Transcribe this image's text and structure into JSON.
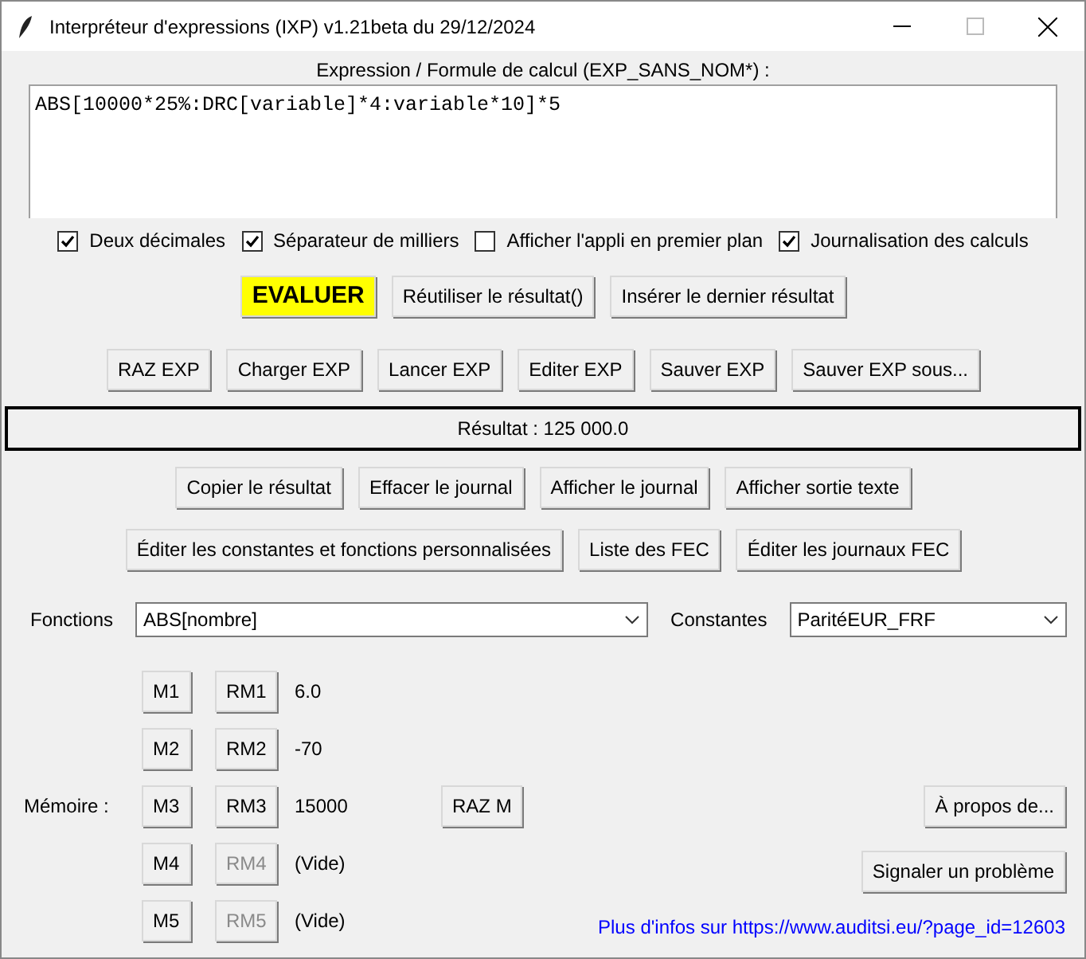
{
  "window": {
    "title": "Interpréteur d'expressions (IXP) v1.21beta du 29/12/2024"
  },
  "expression": {
    "label": "Expression / Formule de calcul (EXP_SANS_NOM*) :",
    "value": "ABS[10000*25%:DRC[variable]*4:variable*10]*5"
  },
  "options": [
    {
      "label": "Deux décimales",
      "checked": true
    },
    {
      "label": "Séparateur de milliers",
      "checked": true
    },
    {
      "label": "Afficher l'appli en premier plan",
      "checked": false
    },
    {
      "label": "Journalisation des calculs",
      "checked": true
    }
  ],
  "action_buttons": [
    {
      "label": "EVALUER",
      "kind": "primary"
    },
    {
      "label": "Réutiliser le résultat()",
      "kind": "normal"
    },
    {
      "label": "Insérer le dernier résultat",
      "kind": "normal"
    }
  ],
  "file_buttons": [
    "RAZ EXP",
    "Charger EXP",
    "Lancer EXP",
    "Editer EXP",
    "Sauver EXP",
    "Sauver EXP sous..."
  ],
  "result": "Résultat : 125 000.0",
  "journal_buttons": [
    "Copier le résultat",
    "Effacer le journal",
    "Afficher le journal",
    "Afficher sortie texte"
  ],
  "fec_buttons": [
    "Éditer les constantes et fonctions personnalisées",
    "Liste des FEC",
    "Éditer les journaux FEC"
  ],
  "functions": {
    "label": "Fonctions",
    "value": "ABS[nombre]"
  },
  "constants": {
    "label": "Constantes",
    "value": "ParitéEUR_FRF"
  },
  "memory": {
    "label": "Mémoire :",
    "reset": "RAZ M",
    "slots": [
      {
        "store": "M1",
        "recall": "RM1",
        "recall_disabled": false,
        "value": "6.0"
      },
      {
        "store": "M2",
        "recall": "RM2",
        "recall_disabled": false,
        "value": "-70"
      },
      {
        "store": "M3",
        "recall": "RM3",
        "recall_disabled": false,
        "value": "15000"
      },
      {
        "store": "M4",
        "recall": "RM4",
        "recall_disabled": true,
        "value": "(Vide)"
      },
      {
        "store": "M5",
        "recall": "RM5",
        "recall_disabled": true,
        "value": "(Vide)"
      }
    ]
  },
  "about_button": "À propos de...",
  "report_button": "Signaler un problème",
  "info_link": "Plus d'infos sur https://www.auditsi.eu/?page_id=12603"
}
